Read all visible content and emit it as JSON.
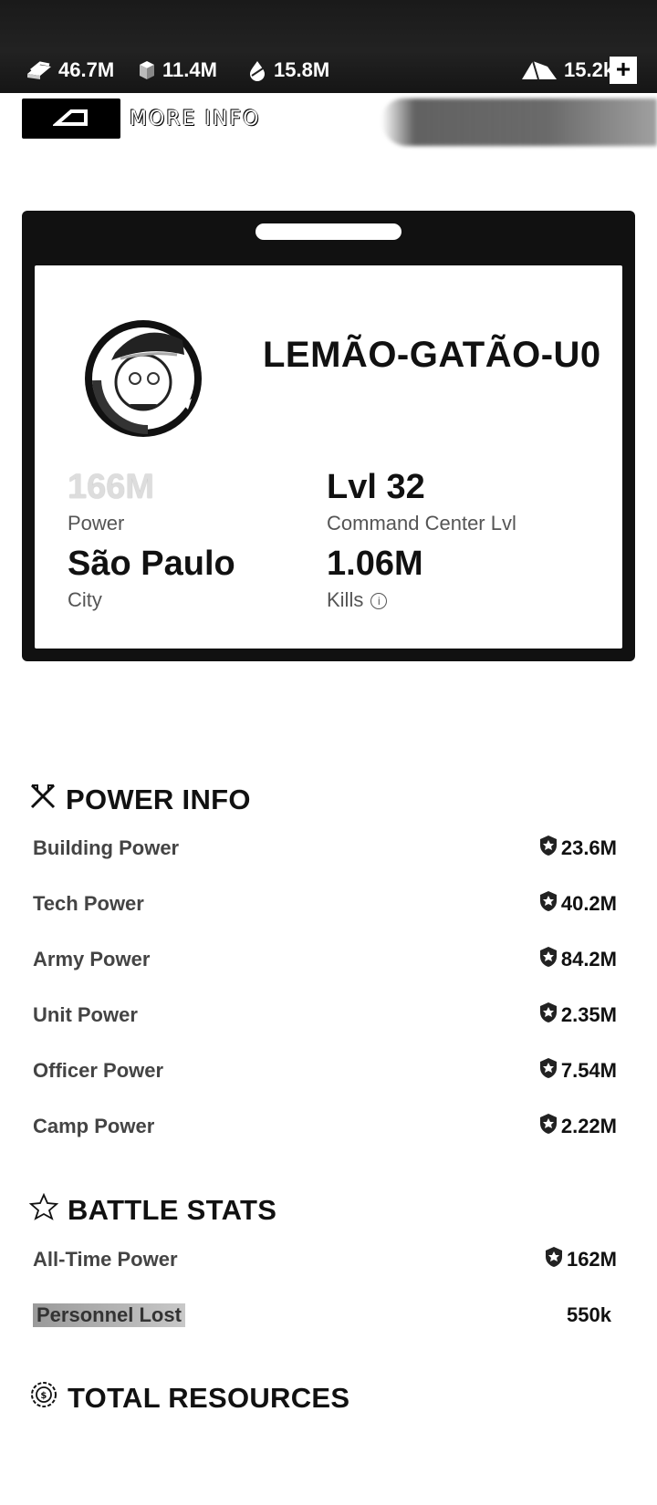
{
  "topbar": {
    "resources": [
      {
        "icon": "gold-bars-icon",
        "value": "46.7M"
      },
      {
        "icon": "iron-icon",
        "value": "11.4M"
      },
      {
        "icon": "oil-icon",
        "value": "15.8M"
      }
    ],
    "premium": {
      "icon": "diamond-icon",
      "value": "15.2k"
    },
    "add_label": "+"
  },
  "more_info": {
    "label": "MORE INFO"
  },
  "profile": {
    "name": "LEMÃO-GATÃO-U0",
    "power_value": "166M",
    "power_label": "Power",
    "cc_value": "Lvl 32",
    "cc_label": "Command Center Lvl",
    "city_value": "São Paulo",
    "city_label": "City",
    "kills_value": "1.06M",
    "kills_label": "Kills"
  },
  "power_info": {
    "title": "POWER INFO",
    "rows": [
      {
        "label": "Building Power",
        "value": "23.6M"
      },
      {
        "label": "Tech Power",
        "value": "40.2M"
      },
      {
        "label": "Army Power",
        "value": "84.2M"
      },
      {
        "label": "Unit Power",
        "value": "2.35M"
      },
      {
        "label": "Officer Power",
        "value": "7.54M"
      },
      {
        "label": "Camp Power",
        "value": "2.22M"
      }
    ]
  },
  "battle_stats": {
    "title": "BATTLE STATS",
    "rows": [
      {
        "label": "All-Time Power",
        "value": "162M"
      },
      {
        "label": "Personnel Lost",
        "value": "550k"
      }
    ]
  },
  "total_resources": {
    "title": "TOTAL RESOURCES"
  },
  "colors": {
    "topbar": "#1a1a1a",
    "card": "#111111",
    "text": "#111111",
    "muted": "#444444"
  }
}
